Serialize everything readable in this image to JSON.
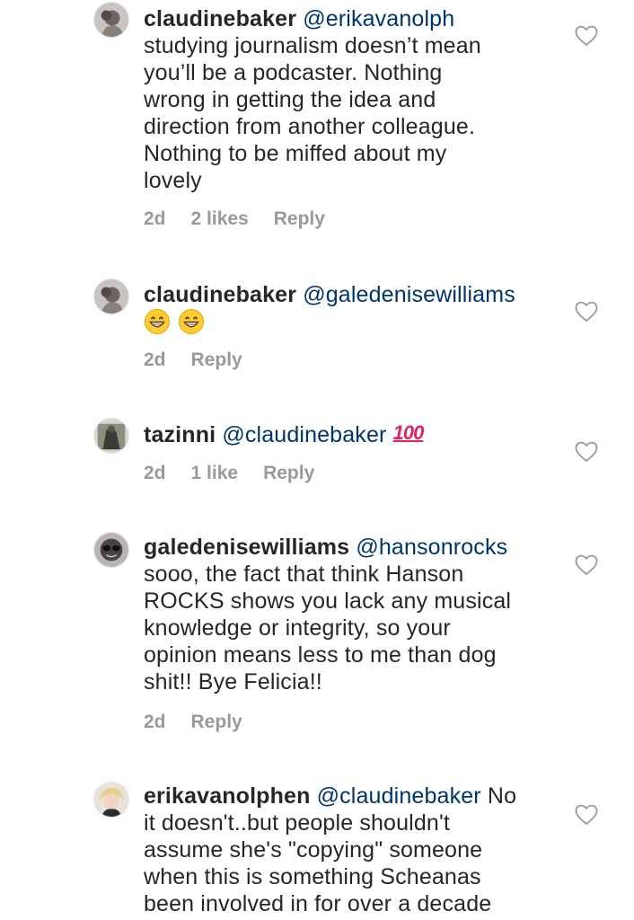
{
  "comments": [
    {
      "username": "claudinebaker",
      "mention": "@erikavanolph",
      "text": "studying journalism doesn’t mean\nyou’ll be a podcaster.  Nothing\nwrong in getting the idea and\ndirection from another colleague.\nNothing to be miffed about my\nlovely",
      "time": "2d",
      "likes": "2 likes",
      "reply": "Reply"
    },
    {
      "username": "claudinebaker",
      "mention": "@galedenisewilliams",
      "emojis": [
        "grinning-face-emoji",
        "grinning-face-emoji"
      ],
      "time": "2d",
      "reply": "Reply"
    },
    {
      "username": "tazinni",
      "mention": "@claudinebaker",
      "emoji_text": "100",
      "time": "2d",
      "likes": "1 like",
      "reply": "Reply"
    },
    {
      "username": "galedenisewilliams",
      "mention": "@hansonrocks",
      "text": "sooo, the fact that think Hanson\nROCKS shows you lack any musical\nknowledge or integrity, so your\nopinion means less to me than dog\nshit!! Bye Felicia!!",
      "time": "2d",
      "reply": "Reply"
    },
    {
      "username": "erikavanolphen",
      "mention": "@claudinebaker",
      "text": " No\nit doesn't..but people shouldn't\nassume she's \"copying\" someone\nwhen this is something Scheanas\nbeen involved in for over a decade"
    }
  ],
  "icons": {
    "like": "heart-outline-icon",
    "emoji": "grinning-face-emoji",
    "hundred": "hundred-points-emoji"
  },
  "colors": {
    "text": "#262626",
    "mention": "#003569",
    "meta": "#999999",
    "heart_stroke": "#9a9a9a"
  }
}
